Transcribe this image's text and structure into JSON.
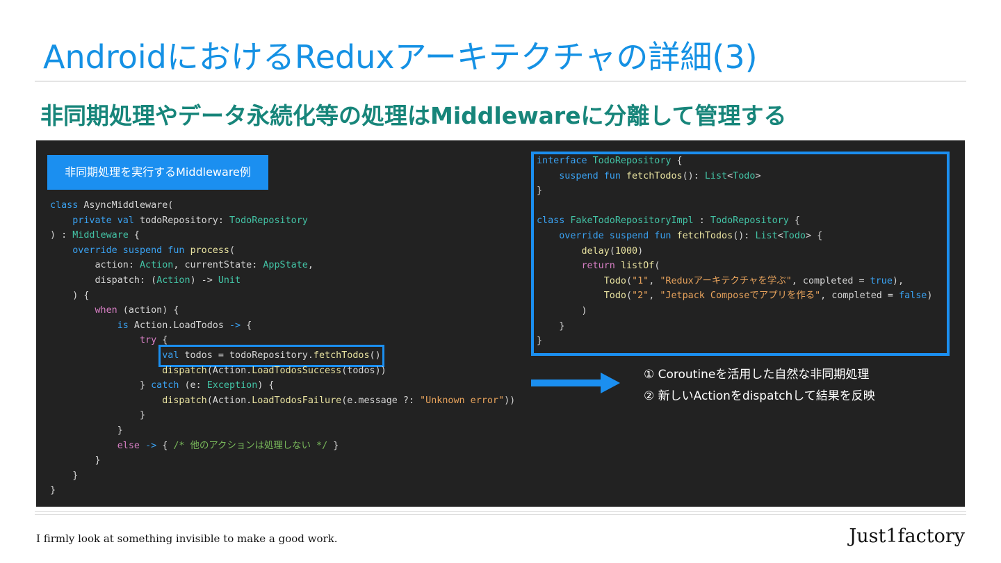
{
  "slide": {
    "title": "AndroidにおけるReduxアーキテクチャの詳細(3)",
    "subtitle": "非同期処理やデータ永続化等の処理はMiddlewareに分離して管理する",
    "badge": "非同期処理を実行するMiddleware例",
    "notes": [
      "① Coroutineを活用した自然な非同期処理",
      "② 新しいActionをdispatchして結果を反映"
    ],
    "footer_tagline": "I firmly look at something invisible to make a good work.",
    "brand": "Just1factory"
  },
  "colors": {
    "title": "#1591e4",
    "subtitle": "#17857a",
    "panel_bg": "#222222",
    "accent": "#1b8ff0",
    "keyword": "#3aa2f2",
    "type": "#43c4a6",
    "string": "#e8a35c",
    "comment": "#78b85a"
  },
  "code_left": [
    [
      [
        "kw",
        "class"
      ],
      [
        "p",
        " AsyncMiddleware("
      ]
    ],
    [
      [
        "p",
        "    "
      ],
      [
        "kw",
        "private val"
      ],
      [
        "p",
        " todoRepository: "
      ],
      [
        "ty",
        "TodoRepository"
      ]
    ],
    [
      [
        "p",
        ") : "
      ],
      [
        "ty",
        "Middleware"
      ],
      [
        "p",
        " {"
      ]
    ],
    [
      [
        "p",
        "    "
      ],
      [
        "kw",
        "override suspend fun"
      ],
      [
        "p",
        " "
      ],
      [
        "fn",
        "process"
      ],
      [
        "p",
        "("
      ]
    ],
    [
      [
        "p",
        "        action: "
      ],
      [
        "ty",
        "Action"
      ],
      [
        "p",
        ", currentState: "
      ],
      [
        "ty",
        "AppState"
      ],
      [
        "p",
        ","
      ]
    ],
    [
      [
        "p",
        "        dispatch: ("
      ],
      [
        "ty",
        "Action"
      ],
      [
        "p",
        ") -> "
      ],
      [
        "ty",
        "Unit"
      ]
    ],
    [
      [
        "p",
        "    ) {"
      ]
    ],
    [
      [
        "p",
        "        "
      ],
      [
        "kw2",
        "when"
      ],
      [
        "p",
        " (action) {"
      ]
    ],
    [
      [
        "p",
        "            "
      ],
      [
        "kw",
        "is"
      ],
      [
        "p",
        " Action.LoadTodos "
      ],
      [
        "kw",
        "->"
      ],
      [
        "p",
        " {"
      ]
    ],
    [
      [
        "p",
        "                "
      ],
      [
        "kw2",
        "try"
      ],
      [
        "p",
        " {"
      ]
    ],
    [
      [
        "p",
        "                    "
      ],
      [
        "hl",
        [
          [
            "kw",
            "val"
          ],
          [
            "p",
            " todos = todoRepository."
          ],
          [
            "fn",
            "fetchTodos"
          ],
          [
            "p",
            "()"
          ]
        ]
      ]
    ],
    [
      [
        "p",
        "                    "
      ],
      [
        "fn",
        "dispatch"
      ],
      [
        "p",
        "(Action."
      ],
      [
        "fn",
        "LoadTodosSuccess"
      ],
      [
        "p",
        "(todos))"
      ]
    ],
    [
      [
        "p",
        "                } "
      ],
      [
        "kw",
        "catch"
      ],
      [
        "p",
        " (e: "
      ],
      [
        "ty",
        "Exception"
      ],
      [
        "p",
        ") {"
      ]
    ],
    [
      [
        "p",
        "                    "
      ],
      [
        "fn",
        "dispatch"
      ],
      [
        "p",
        "(Action."
      ],
      [
        "fn",
        "LoadTodosFailure"
      ],
      [
        "p",
        "(e.message ?: "
      ],
      [
        "st",
        "\"Unknown error\""
      ],
      [
        "p",
        "))"
      ]
    ],
    [
      [
        "p",
        "                }"
      ]
    ],
    [
      [
        "p",
        "            }"
      ]
    ],
    [
      [
        "p",
        "            "
      ],
      [
        "kw2",
        "else"
      ],
      [
        "p",
        " "
      ],
      [
        "kw",
        "->"
      ],
      [
        "p",
        " { "
      ],
      [
        "cm",
        "/* 他のアクションは処理しない */"
      ],
      [
        "p",
        " }"
      ]
    ],
    [
      [
        "p",
        "        }"
      ]
    ],
    [
      [
        "p",
        "    }"
      ]
    ],
    [
      [
        "p",
        "}"
      ]
    ]
  ],
  "code_right": [
    [
      [
        "kw",
        "interface"
      ],
      [
        "p",
        " "
      ],
      [
        "ty",
        "TodoRepository"
      ],
      [
        "p",
        " {"
      ]
    ],
    [
      [
        "p",
        "    "
      ],
      [
        "kw",
        "suspend fun"
      ],
      [
        "p",
        " "
      ],
      [
        "fn",
        "fetchTodos"
      ],
      [
        "p",
        "(): "
      ],
      [
        "ty",
        "List"
      ],
      [
        "p",
        "<"
      ],
      [
        "ty",
        "Todo"
      ],
      [
        "p",
        ">"
      ]
    ],
    [
      [
        "p",
        "}"
      ]
    ],
    [
      [
        "p",
        ""
      ]
    ],
    [
      [
        "kw",
        "class"
      ],
      [
        "p",
        " "
      ],
      [
        "ty",
        "FakeTodoRepositoryImpl"
      ],
      [
        "p",
        " : "
      ],
      [
        "ty",
        "TodoRepository"
      ],
      [
        "p",
        " {"
      ]
    ],
    [
      [
        "p",
        "    "
      ],
      [
        "kw",
        "override suspend fun"
      ],
      [
        "p",
        " "
      ],
      [
        "fn",
        "fetchTodos"
      ],
      [
        "p",
        "(): "
      ],
      [
        "ty",
        "List"
      ],
      [
        "p",
        "<"
      ],
      [
        "ty",
        "Todo"
      ],
      [
        "p",
        "> {"
      ]
    ],
    [
      [
        "p",
        "        "
      ],
      [
        "fn",
        "delay"
      ],
      [
        "p",
        "("
      ],
      [
        "nm",
        "1000"
      ],
      [
        "p",
        ")"
      ]
    ],
    [
      [
        "p",
        "        "
      ],
      [
        "kw2",
        "return"
      ],
      [
        "p",
        " "
      ],
      [
        "fn",
        "listOf"
      ],
      [
        "p",
        "("
      ]
    ],
    [
      [
        "p",
        "            "
      ],
      [
        "fn",
        "Todo"
      ],
      [
        "p",
        "("
      ],
      [
        "st",
        "\"1\""
      ],
      [
        "p",
        ", "
      ],
      [
        "st",
        "\"Reduxアーキテクチャを学ぶ\""
      ],
      [
        "p",
        ", completed = "
      ],
      [
        "kw",
        "true"
      ],
      [
        "p",
        "),"
      ]
    ],
    [
      [
        "p",
        "            "
      ],
      [
        "fn",
        "Todo"
      ],
      [
        "p",
        "("
      ],
      [
        "st",
        "\"2\""
      ],
      [
        "p",
        ", "
      ],
      [
        "st",
        "\"Jetpack Composeでアプリを作る\""
      ],
      [
        "p",
        ", completed = "
      ],
      [
        "kw",
        "false"
      ],
      [
        "p",
        ")"
      ]
    ],
    [
      [
        "p",
        "        )"
      ]
    ],
    [
      [
        "p",
        "    }"
      ]
    ],
    [
      [
        "p",
        "}"
      ]
    ]
  ]
}
